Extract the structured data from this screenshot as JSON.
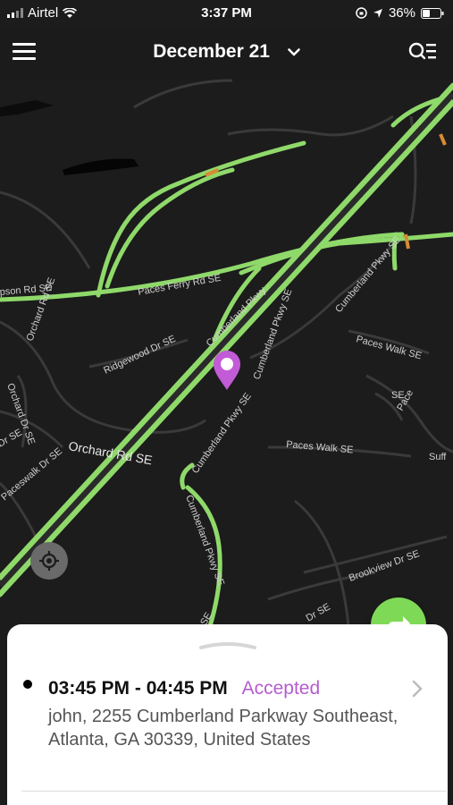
{
  "status_bar": {
    "carrier": "Airtel",
    "time": "3:37 PM",
    "battery": "36%"
  },
  "header": {
    "date": "December 21"
  },
  "map": {
    "labels": {
      "paces_ferry_rd": "Paces Ferry Rd SE",
      "pson_rd": "pson Rd SE",
      "orchard_rd_small": "Orchard Rd SE",
      "ridgewood_dr": "Ridgewood Dr SE",
      "orchard_rd_big": "Orchard Rd SE",
      "paces_walk_top": "Paces Walk SE",
      "paces_walk_mid": "Paces Walk SE",
      "cumberland_pkwy_1": "Cumberland Pkwy SE",
      "cumberland_pkwy_2": "Cumberland Pkwy SE",
      "cumberland_pkwy_3": "Cumberland Pkwy SE",
      "cumberland_pkwy_4": "Cumberland Pkwy SE",
      "brookview_dr": "Brookview Dr SE",
      "paceswalk_dr": "Paceswalk Dr SE",
      "orchard_dr_left": "Orchard Dr SE",
      "dr_se_left": "Dr SE",
      "dr_se_bottom": "Dr SE",
      "suff": "Suff",
      "pace": "Pace",
      "se_small": "SE",
      "hwy": "Cumberland Pkwy",
      "bottom_se": "SE"
    },
    "colors": {
      "road_major": "#8fd96a",
      "road_minor": "#3a3a3a",
      "water": "#0a0a0a",
      "pin": "#c25bd6",
      "traffic_orange": "#d98a32"
    }
  },
  "appointment": {
    "time_range": "03:45 PM - 04:45 PM",
    "status": "Accepted",
    "status_color": "#b45ccf",
    "address": "john, 2255 Cumberland Parkway Southeast, Atlanta, GA 30339, United States"
  }
}
